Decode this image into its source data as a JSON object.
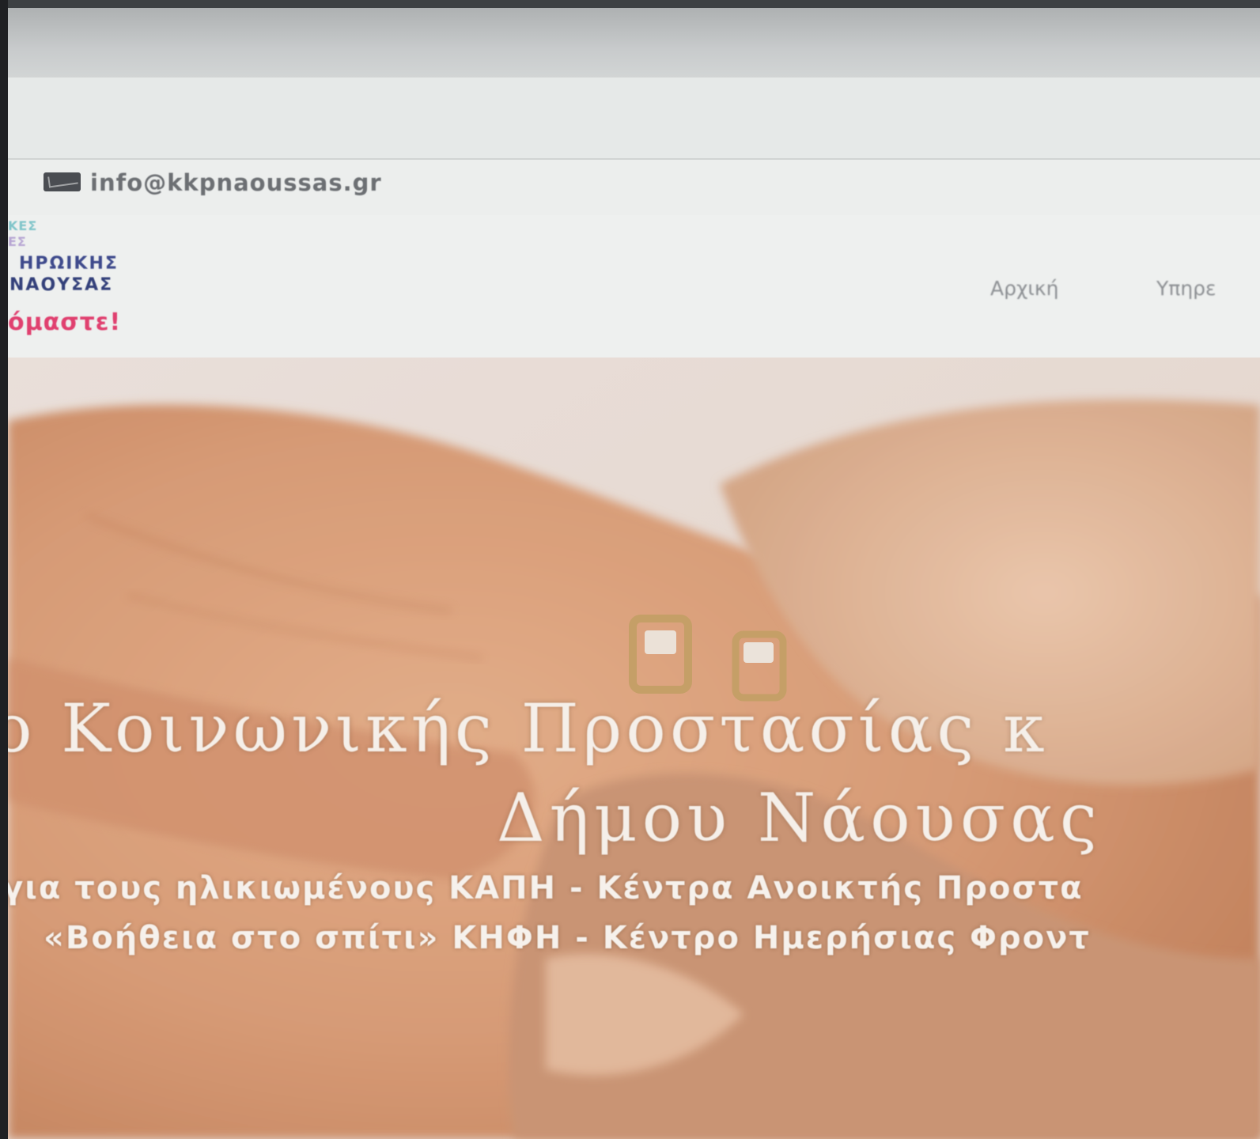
{
  "topbar": {
    "email": "info@kkpnaoussas.gr",
    "mail_icon": "envelope-icon"
  },
  "logo": {
    "line1": "ΚΕΣ",
    "line2": "ΕΣ",
    "line3": "ΗΡΩΙΚΗΣ",
    "line4": "ΝΑΟΥΣΑΣ",
    "slogan": "όμαστε!"
  },
  "nav": {
    "home": "Αρχική",
    "services": "Υπηρε"
  },
  "hero": {
    "title_line1": "ο Κοινωνικής Προστασίας κ",
    "title_line2": "Δήμου Νάουσας",
    "sub_line1": "για τους ηλικιωμένους ΚΑΠΗ - Κέντρα Ανοικτής Προστα",
    "sub_line2": "«Βοήθεια στο σπίτι» ΚΗΦΗ - Κέντρο Ημερήσιας Φροντ"
  },
  "colors": {
    "logo_teal": "#7fc4c9",
    "logo_lilac": "#b7a6d3",
    "logo_navy": "#3e4a8c",
    "logo_pink": "#e0406f",
    "nav_text": "#8c8f93",
    "hero_text": "#f5efe9",
    "hero_tint": "#d9a380"
  }
}
